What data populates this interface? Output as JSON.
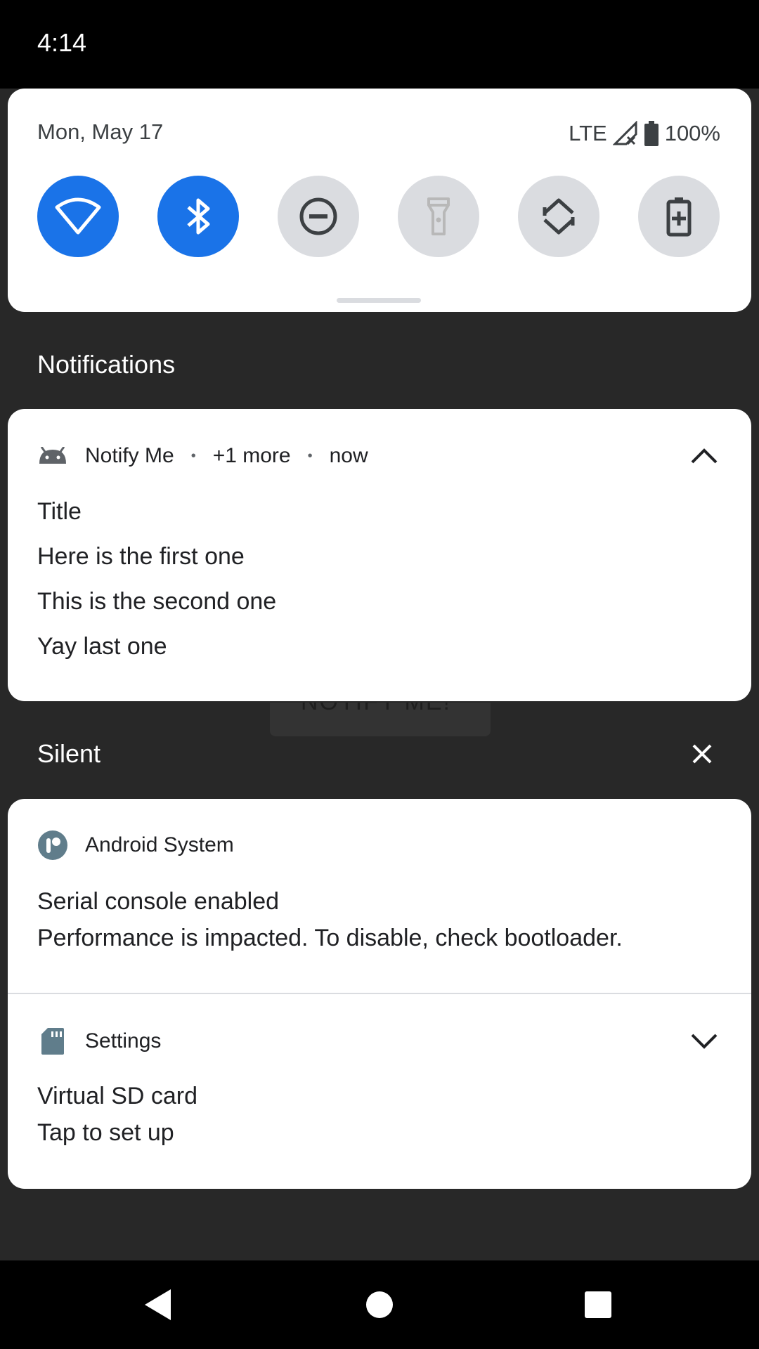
{
  "status_bar": {
    "time": "4:14"
  },
  "quick_settings": {
    "date": "Mon, May 17",
    "network": "LTE",
    "battery": "100%",
    "tiles": [
      {
        "name": "wifi",
        "state": "on"
      },
      {
        "name": "bluetooth",
        "state": "on"
      },
      {
        "name": "do-not-disturb",
        "state": "off"
      },
      {
        "name": "flashlight",
        "state": "unavailable"
      },
      {
        "name": "auto-rotate",
        "state": "off"
      },
      {
        "name": "battery-saver",
        "state": "off"
      }
    ]
  },
  "sections": {
    "notifications_label": "Notifications",
    "silent_label": "Silent"
  },
  "notif_group": {
    "app_name": "Notify Me",
    "more": "+1 more",
    "time": "now",
    "separator": "•",
    "lines": [
      "Title",
      "Here is the first one",
      "This is the second one",
      "Yay last one"
    ]
  },
  "background_button": {
    "label": "NOTIFY ME!"
  },
  "silent_notifs": [
    {
      "app_name": "Android System",
      "title": "Serial console enabled",
      "text": "Performance is impacted. To disable, check bootloader."
    },
    {
      "app_name": "Settings",
      "title": "Virtual SD card",
      "text": "Tap to set up"
    }
  ],
  "colors": {
    "accent": "#1a73e8",
    "tile_off": "#dadce0",
    "shade_background": "#282828",
    "android_system_icon": "#607d8b"
  }
}
